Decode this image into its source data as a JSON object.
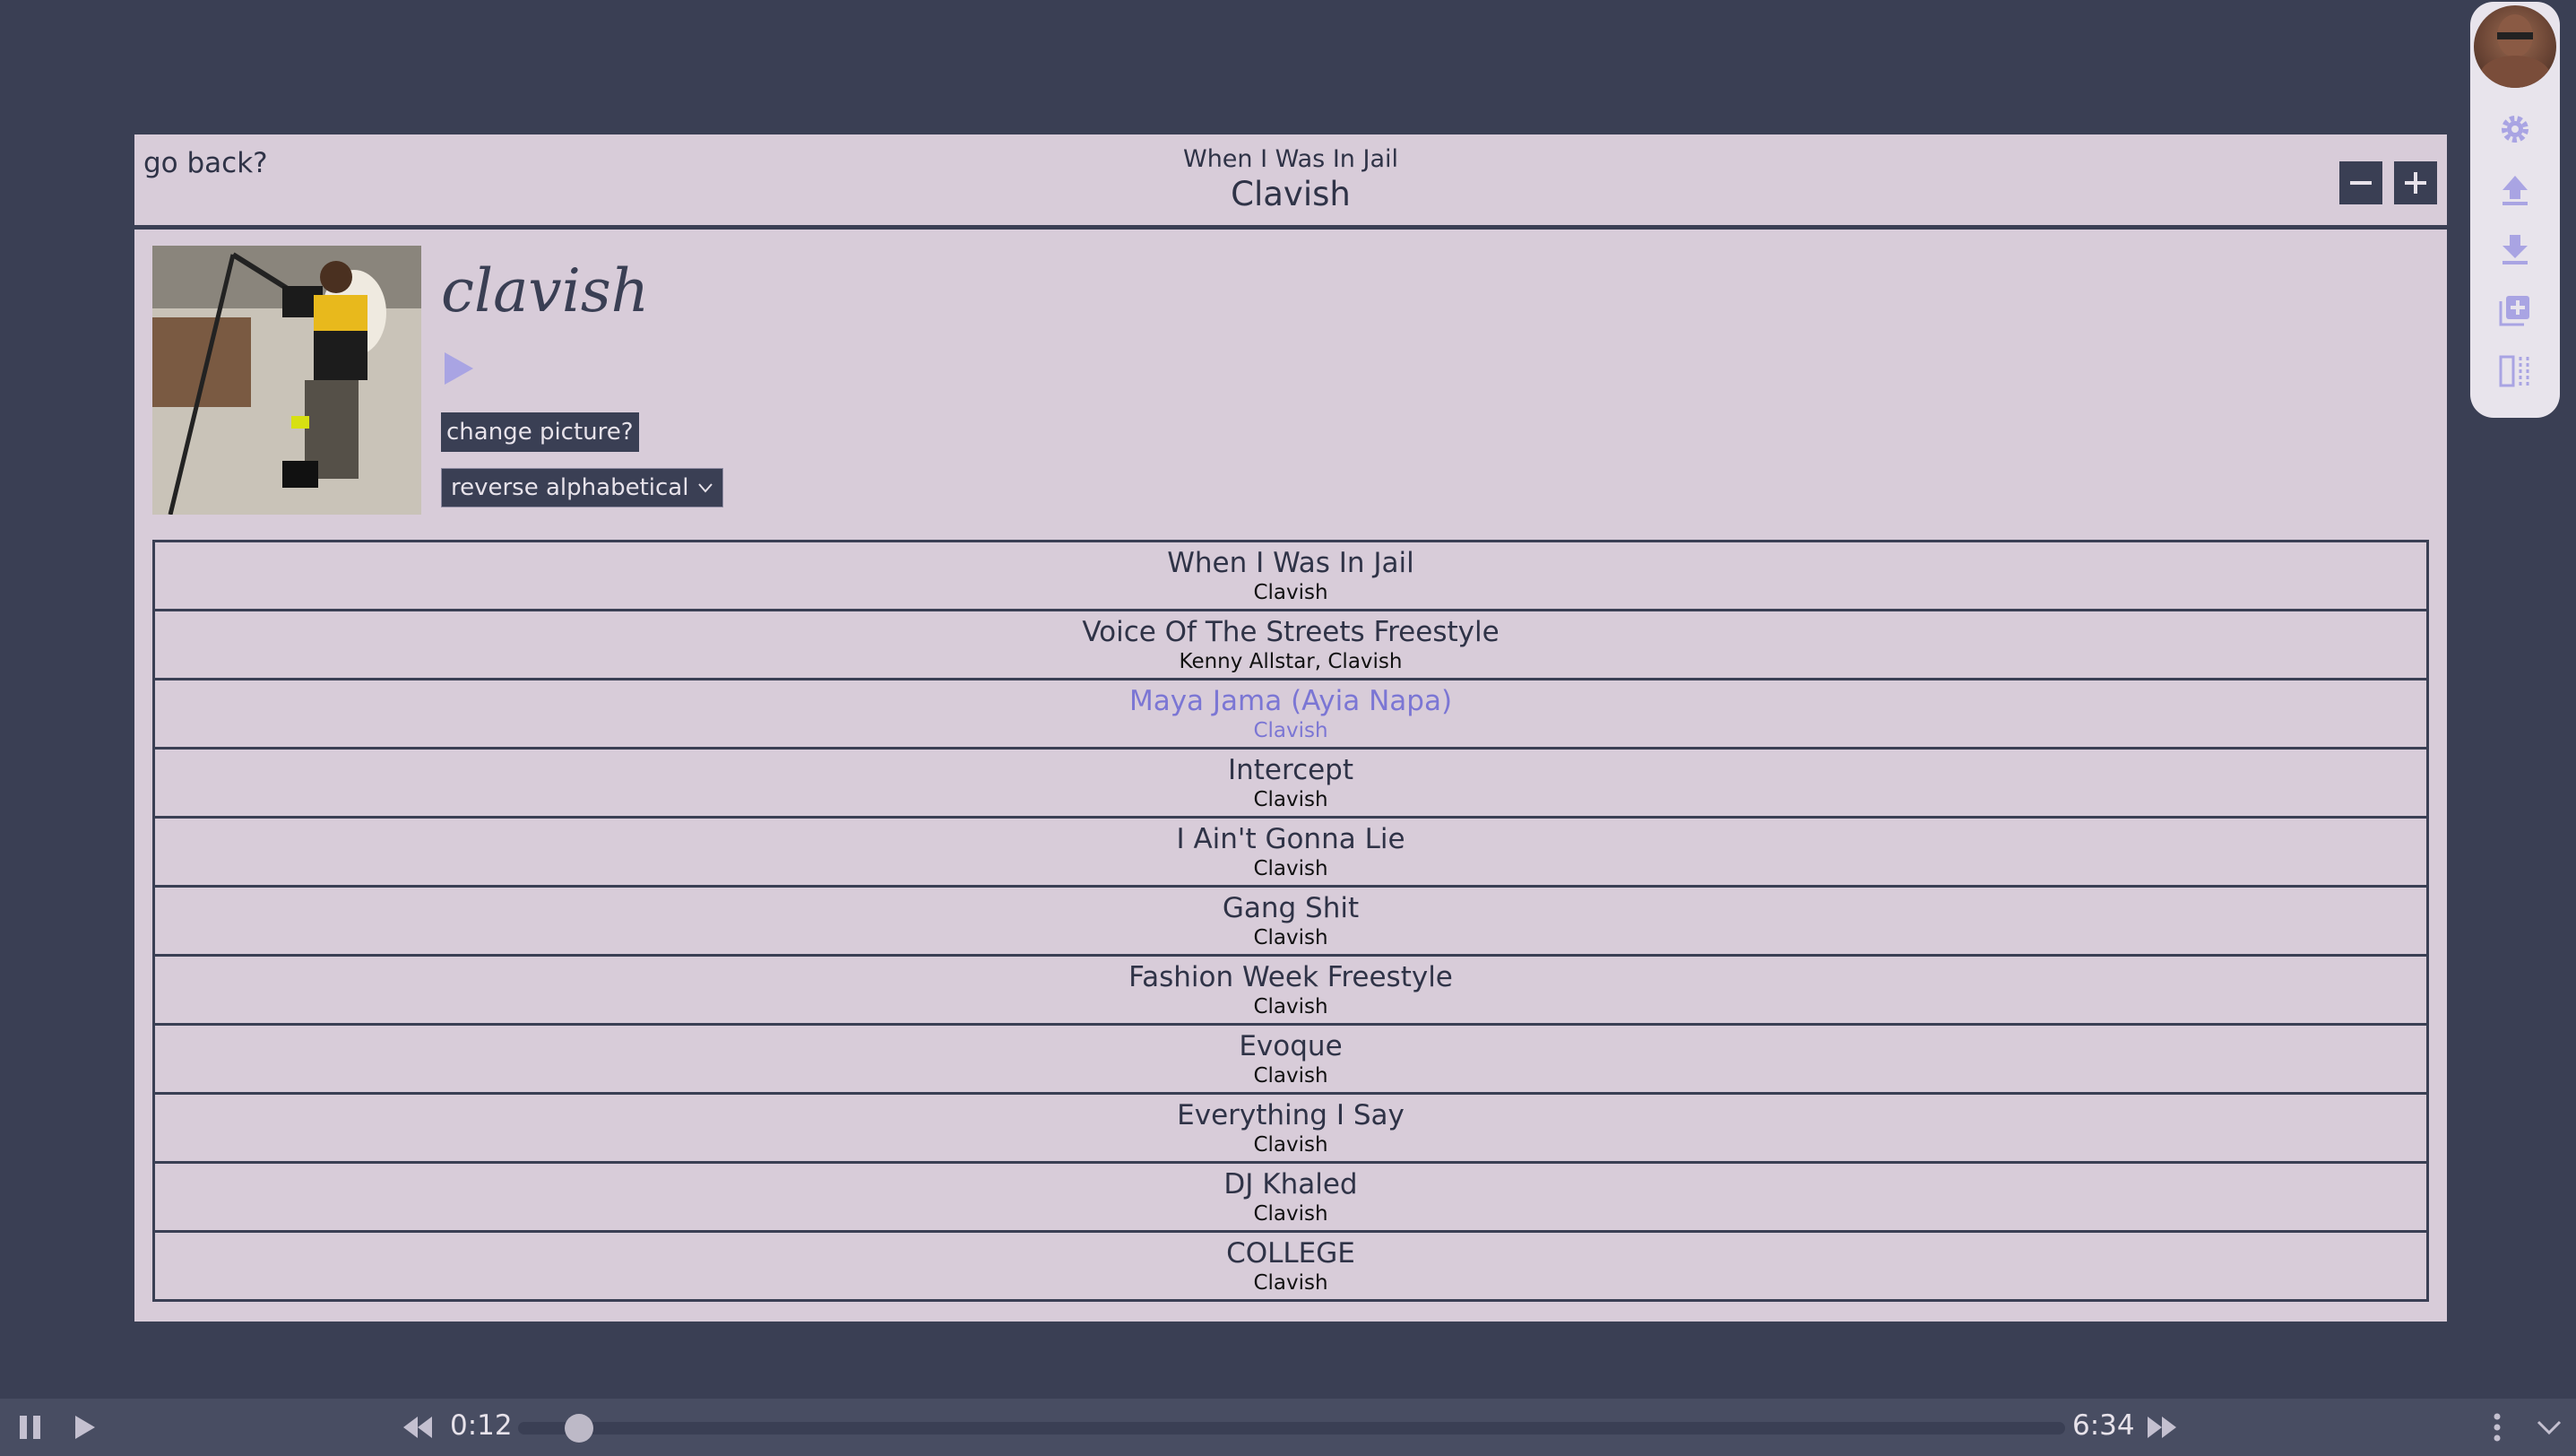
{
  "header": {
    "back_label": "go back?",
    "now_playing_title": "When I Was In Jail",
    "artist": "Clavish"
  },
  "artist_page": {
    "name": "clavish",
    "change_picture_label": "change picture?",
    "sort_value": "reverse alphabetical"
  },
  "tracks": [
    {
      "title": "When I Was In Jail",
      "artist": "Clavish",
      "active": false
    },
    {
      "title": "Voice Of The Streets Freestyle",
      "artist": "Kenny Allstar, Clavish",
      "active": false
    },
    {
      "title": "Maya Jama (Ayia Napa)",
      "artist": "Clavish",
      "active": true
    },
    {
      "title": "Intercept",
      "artist": "Clavish",
      "active": false
    },
    {
      "title": "I Ain't Gonna Lie",
      "artist": "Clavish",
      "active": false
    },
    {
      "title": "Gang Shit",
      "artist": "Clavish",
      "active": false
    },
    {
      "title": "Fashion Week Freestyle",
      "artist": "Clavish",
      "active": false
    },
    {
      "title": "Evoque",
      "artist": "Clavish",
      "active": false
    },
    {
      "title": "Everything I Say",
      "artist": "Clavish",
      "active": false
    },
    {
      "title": "DJ Khaled",
      "artist": "Clavish",
      "active": false
    },
    {
      "title": "COLLEGE",
      "artist": "Clavish",
      "active": false
    }
  ],
  "sidebar": {
    "icons": [
      "settings-icon",
      "upload-icon",
      "download-icon",
      "add-playlist-icon",
      "split-view-icon"
    ]
  },
  "player": {
    "current_time": "0:12",
    "total_time": "6:34",
    "progress": 0.03
  },
  "colors": {
    "background": "#3a3f54",
    "panel": "#d8ccd9",
    "accent": "#7b76d4"
  }
}
